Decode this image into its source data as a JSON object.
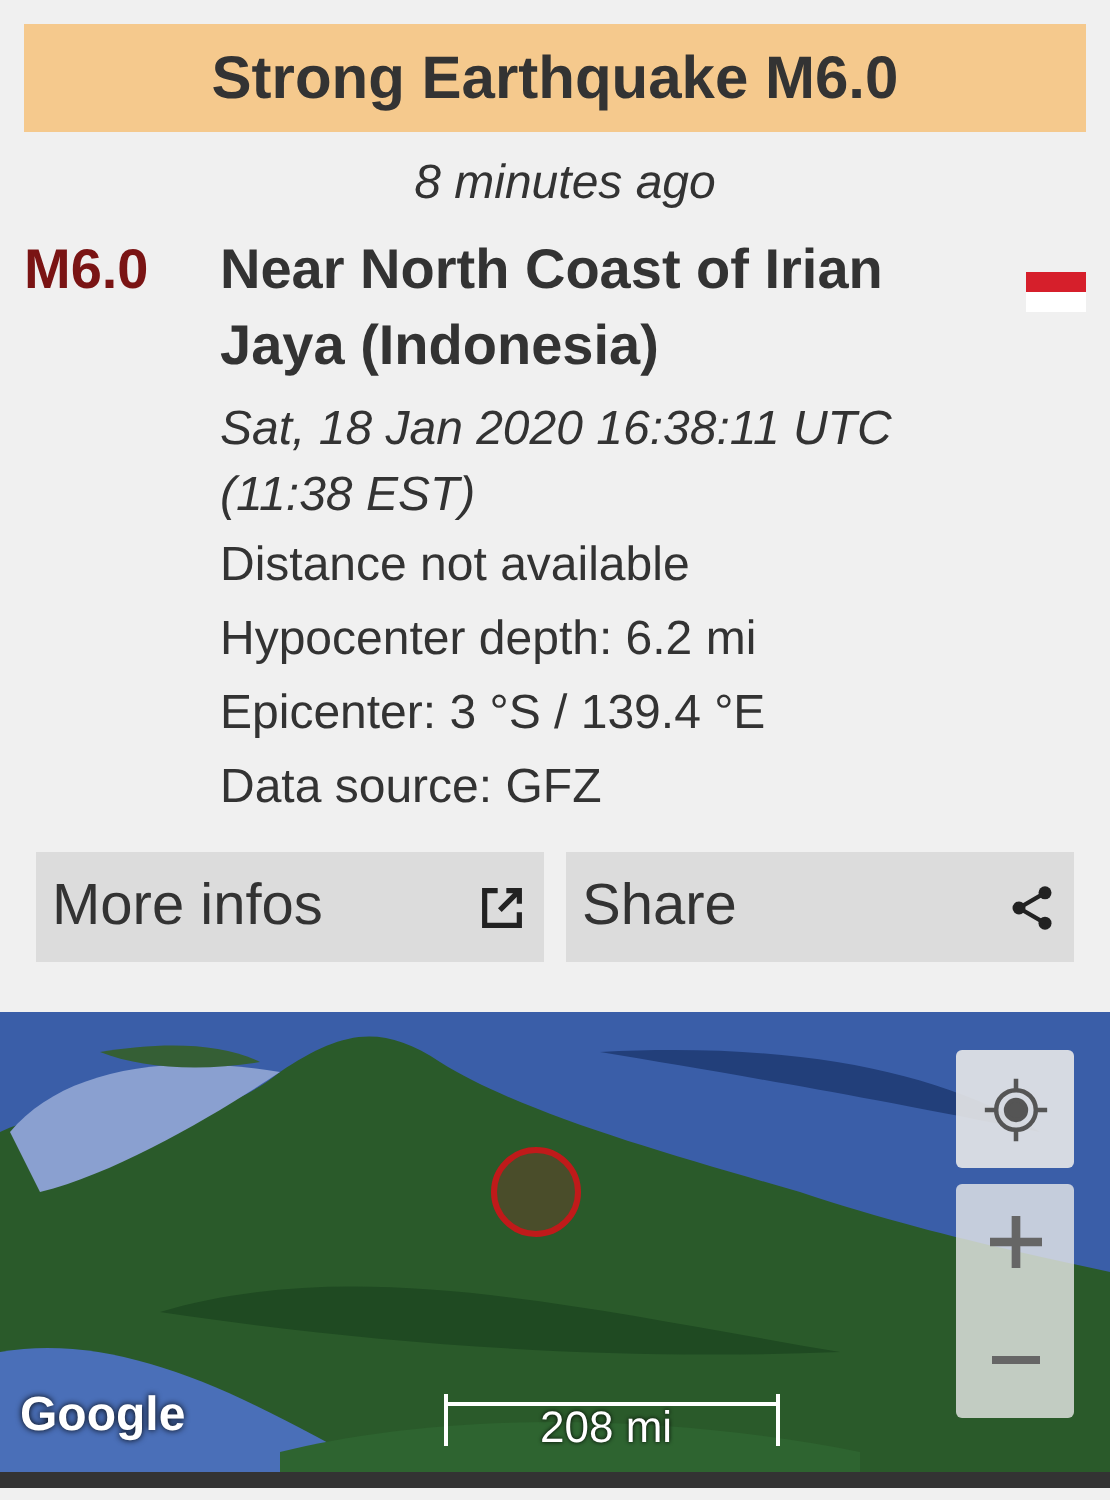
{
  "header": {
    "title": "Strong Earthquake M6.0"
  },
  "time_ago": "8 minutes ago",
  "quake": {
    "magnitude": "M6.0",
    "region": "Near North Coast of Irian Jaya (Indonesia)",
    "datetime": "Sat, 18 Jan 2020 16:38:11 UTC (11:38 EST)",
    "details": [
      "Distance not available",
      "Hypocenter depth: 6.2 mi",
      "Epicenter: 3 °S / 139.4 °E",
      "Data source: GFZ"
    ]
  },
  "buttons": [
    {
      "label": "More infos",
      "kind": "external"
    },
    {
      "label": "Share",
      "kind": "share"
    }
  ],
  "map": {
    "attribution": "Google",
    "scale": "208 mi"
  }
}
